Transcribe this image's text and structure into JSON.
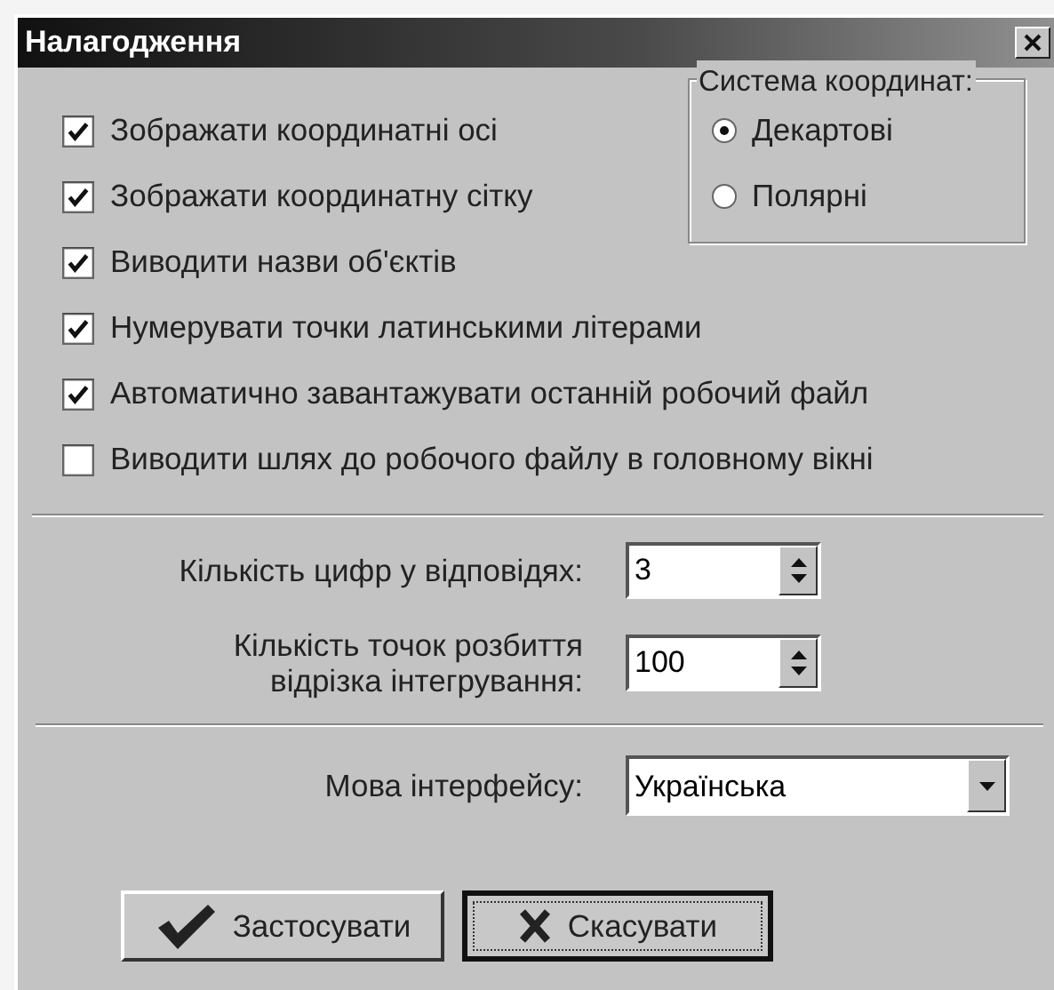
{
  "window": {
    "title": "Налагодження"
  },
  "options": [
    {
      "label": "Зображати координатні осі",
      "checked": true
    },
    {
      "label": "Зображати координатну сітку",
      "checked": true
    },
    {
      "label": "Виводити назви об'єктів",
      "checked": true
    },
    {
      "label": "Нумерувати точки латинськими літерами",
      "checked": true
    },
    {
      "label": "Автоматично завантажувати останній робочий файл",
      "checked": true
    },
    {
      "label": "Виводити шлях до робочого файлу в головному вікні",
      "checked": false
    }
  ],
  "coordinate_system": {
    "title": "Система координат:",
    "options": [
      {
        "label": "Декартові",
        "selected": true
      },
      {
        "label": "Полярні",
        "selected": false
      }
    ]
  },
  "spinners": [
    {
      "label": "Кількість цифр у відповідях:",
      "value": "3"
    },
    {
      "label": "Кількість точок розбиття відрізка інтегрування:",
      "value": "100"
    }
  ],
  "language": {
    "label": "Мова інтерфейсу:",
    "value": "Українська"
  },
  "buttons": [
    {
      "label": "Застосувати",
      "kind": "apply",
      "focused": false
    },
    {
      "label": "Скасувати",
      "kind": "cancel",
      "focused": true
    }
  ]
}
